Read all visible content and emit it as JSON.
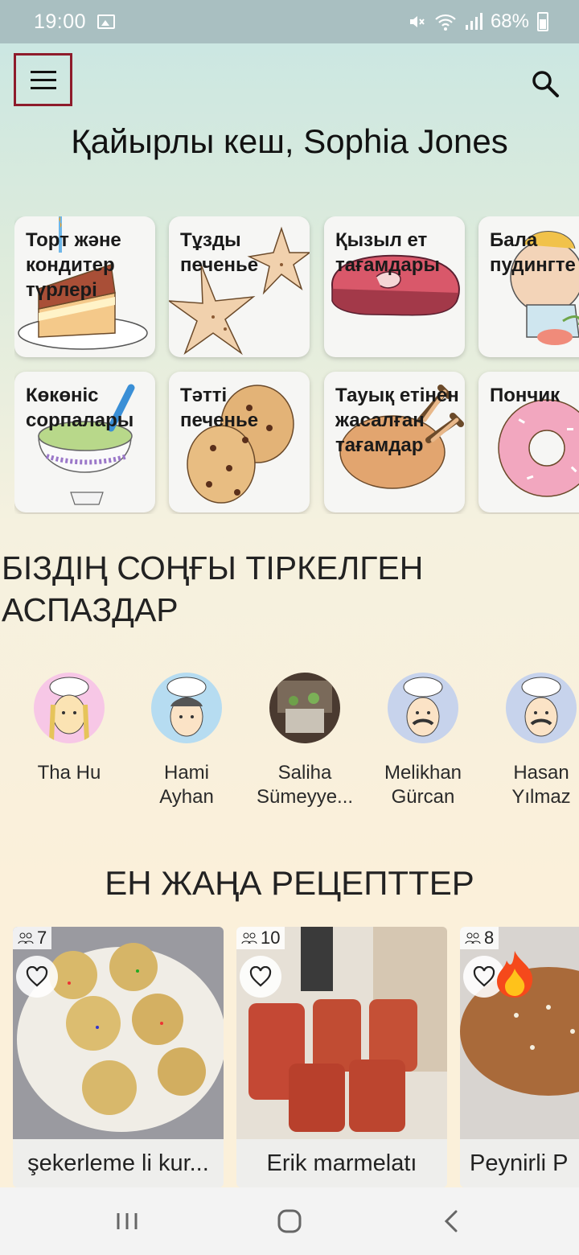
{
  "status_bar": {
    "time": "19:00",
    "battery": "68%",
    "icons": [
      "gallery-icon",
      "mute-icon",
      "wifi-icon",
      "signal-icon",
      "battery-icon"
    ]
  },
  "header": {
    "menu_icon": "hamburger-menu-icon",
    "search_icon": "search-icon",
    "greeting": "Қайырлы кеш, Sophia Jones"
  },
  "categories": [
    {
      "label": "Торт және кондитер түрлері",
      "icon": "cake-illustration"
    },
    {
      "label": "Тұзды печенье",
      "icon": "star-cookies-illustration"
    },
    {
      "label": "Қызыл ет тағамдары",
      "icon": "steak-illustration"
    },
    {
      "label": "Бала пудингте",
      "icon": "baby-illustration"
    },
    {
      "label": "Көкөніс сорпалары",
      "icon": "soup-bowl-illustration"
    },
    {
      "label": "Тәтті печенье",
      "icon": "chocolate-chip-cookie-illustration"
    },
    {
      "label": "Тауық етінен жасалған тағамдар",
      "icon": "roast-chicken-illustration"
    },
    {
      "label": "Пончик",
      "icon": "donut-illustration"
    }
  ],
  "chefs_section": {
    "title": "БІЗДІҢ СОҢҒЫ ТІРКЕЛГЕН АСПАЗДАР",
    "chefs": [
      {
        "name": "Tha Hu"
      },
      {
        "name": "Hami Ayhan"
      },
      {
        "name": "Saliha Sümeyye..."
      },
      {
        "name": "Melikhan Gürcan"
      },
      {
        "name": "Hasan Yılmaz"
      }
    ]
  },
  "recipes_section": {
    "title": "ЕН ЖАҢА РЕЦЕПТТЕР",
    "recipes": [
      {
        "title": "şekerleme li kur...",
        "servings": "7"
      },
      {
        "title": "Erik marmelatı",
        "servings": "10"
      },
      {
        "title": "Peynirli P",
        "servings": "8"
      }
    ]
  },
  "colors": {
    "menu_highlight": "#8e1b2b",
    "status_bar": "#a9bfc1"
  }
}
